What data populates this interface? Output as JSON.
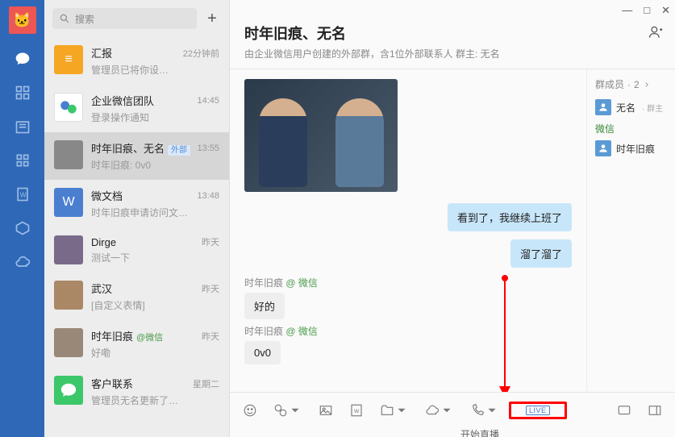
{
  "rail": {
    "icons": [
      "chat",
      "contacts",
      "calendar",
      "apps",
      "docs",
      "meeting",
      "cloud"
    ]
  },
  "search": {
    "placeholder": "搜索"
  },
  "convs": [
    {
      "name": "汇报",
      "sub": "管理员已将你设…",
      "time": "22分钟前",
      "avBg": "#f5a623",
      "avText": "≡"
    },
    {
      "name": "企业微信团队",
      "sub": "登录操作通知",
      "time": "14:45",
      "avBg": "#fff",
      "avText": "",
      "logo": true
    },
    {
      "name": "时年旧痕、无名",
      "sub": "时年旧痕: 0v0",
      "time": "13:55",
      "avBg": "#888",
      "ext": "外部",
      "sel": true
    },
    {
      "name": "微文档",
      "sub": "时年旧痕申请访问文…",
      "time": "13:48",
      "avBg": "#4a7fd0",
      "avText": "W"
    },
    {
      "name": "Dirge",
      "sub": "测试一下",
      "time": "昨天",
      "avBg": "#7a6a8a"
    },
    {
      "name": "武汉",
      "sub": "[自定义表情]",
      "time": "昨天",
      "avBg": "#aa8866"
    },
    {
      "name": "时年旧痕",
      "sub": "好嘞",
      "time": "昨天",
      "avBg": "#998877",
      "ws": "@微信"
    },
    {
      "name": "客户联系",
      "sub": "管理员无名更新了…",
      "time": "星期二",
      "avBg": "#3cc76a",
      "chat": true
    }
  ],
  "chat": {
    "title": "时年旧痕、无名",
    "desc": "由企业微信用户创建的外部群，含1位外部联系人 群主: 无名",
    "members_head": "群成员",
    "members_count": "2",
    "members_section": "微信",
    "members": [
      {
        "name": "无名",
        "tag": "· 群主"
      },
      {
        "name": "时年旧痕"
      }
    ],
    "out": [
      "看到了，我继续上班了",
      "溜了溜了"
    ],
    "in": [
      {
        "sender": "时年旧痕",
        "via": "@ 微信",
        "text": "好的"
      },
      {
        "sender": "时年旧痕",
        "via": "@ 微信",
        "text": "0v0"
      }
    ],
    "live_label": "LIVE",
    "start_live": "开始直播"
  },
  "win": {
    "min": "—",
    "max": "□",
    "close": "✕"
  }
}
